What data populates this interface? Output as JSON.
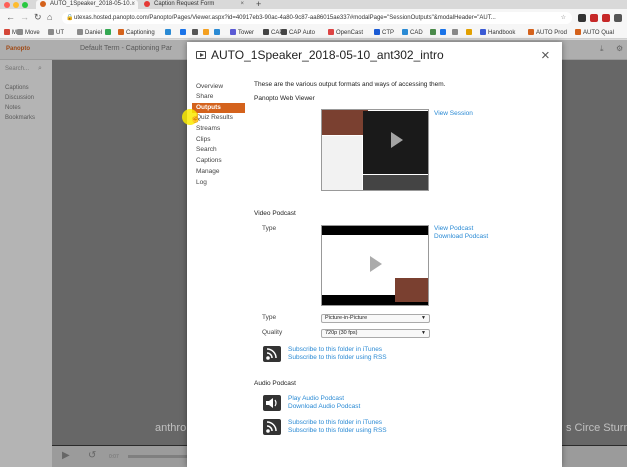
{
  "browser": {
    "tabs": [
      {
        "label": "AUTO_1Speaker_2018-05-10..."
      },
      {
        "label": "Caption Request Form"
      }
    ],
    "new_tab": "+",
    "nav": {
      "back": "←",
      "forward": "→",
      "reload": "↻",
      "home": "⌂"
    },
    "url": "utexas.hosted.panopto.com/Panopto/Pages/Viewer.aspx?id=40917eb3-90ac-4a80-9c87-aa86015ae337#modalPage=\"SessionOutputs\"&modalHeader=\"AUT...",
    "bookmarks": [
      {
        "label": "M",
        "color": "#d44638"
      },
      {
        "label": "Move",
        "color": "#8a8a8a"
      },
      {
        "label": "UT",
        "color": "#8a8a8a"
      },
      {
        "label": "Daniel",
        "color": "#8a8a8a"
      },
      {
        "label": "",
        "color": "#33a852"
      },
      {
        "label": "Captioning",
        "color": "#d4621c"
      },
      {
        "label": "",
        "color": "#2a8ad4"
      },
      {
        "label": "",
        "color": "#1a73e8"
      },
      {
        "label": "",
        "color": "#555"
      },
      {
        "label": "",
        "color": "#f4a020"
      },
      {
        "label": "",
        "color": "#2a8ad4"
      },
      {
        "label": "Tower",
        "color": "#5a5ad4"
      },
      {
        "label": "CAP",
        "color": "#444"
      },
      {
        "label": "CAP Auto",
        "color": "#444"
      },
      {
        "label": "OpenCast",
        "color": "#d44"
      },
      {
        "label": "CTP",
        "color": "#1a5ad4"
      },
      {
        "label": "CAD",
        "color": "#2a8ad4"
      },
      {
        "label": "",
        "color": "#4a8a4a"
      },
      {
        "label": "",
        "color": "#1a73e8"
      },
      {
        "label": "",
        "color": "#888"
      },
      {
        "label": "",
        "color": "#e2a000"
      },
      {
        "label": "Handbook",
        "color": "#3a5ad4"
      },
      {
        "label": "AUTO Prod",
        "color": "#d4621c"
      },
      {
        "label": "AUTO Qual",
        "color": "#d4621c"
      }
    ]
  },
  "background_page": {
    "logo": "Panopto",
    "folder": "Default Term - Captioning Par",
    "search_placeholder": "Search...",
    "side_items": [
      "Captions",
      "Discussion",
      "Notes",
      "Bookmarks"
    ],
    "caption_left": "anthro",
    "caption_right": "s Circe Sturm",
    "time": "0:07"
  },
  "modal": {
    "title": "AUTO_1Speaker_2018-05-10_ant302_intro",
    "close": "×",
    "nav": {
      "items": [
        "Overview",
        "Share",
        "Outputs",
        "Quiz Results",
        "Streams",
        "Clips",
        "Search",
        "Captions",
        "Manage",
        "Log"
      ],
      "active": "Outputs"
    },
    "intro": "These are the various output formats and ways of accessing them.",
    "web_viewer": {
      "heading": "Panopto Web Viewer",
      "link": "View Session"
    },
    "video_podcast": {
      "heading": "Video Podcast",
      "type_label": "Type",
      "links": [
        "View Podcast",
        "Download Podcast"
      ],
      "type_select_label": "Type",
      "type_value": "Picture-in-Picture",
      "quality_label": "Quality",
      "quality_value": "720p (30 fps)",
      "rss_links": [
        "Subscribe to this folder in iTunes",
        "Subscribe to this folder using RSS"
      ]
    },
    "audio_podcast": {
      "heading": "Audio Podcast",
      "links": [
        "Play Audio Podcast",
        "Download Audio Podcast"
      ],
      "rss_links": [
        "Subscribe to this folder in iTunes",
        "Subscribe to this folder using RSS"
      ]
    }
  },
  "colors": {
    "accent": "#d4621c",
    "link": "#2a8ad4"
  }
}
